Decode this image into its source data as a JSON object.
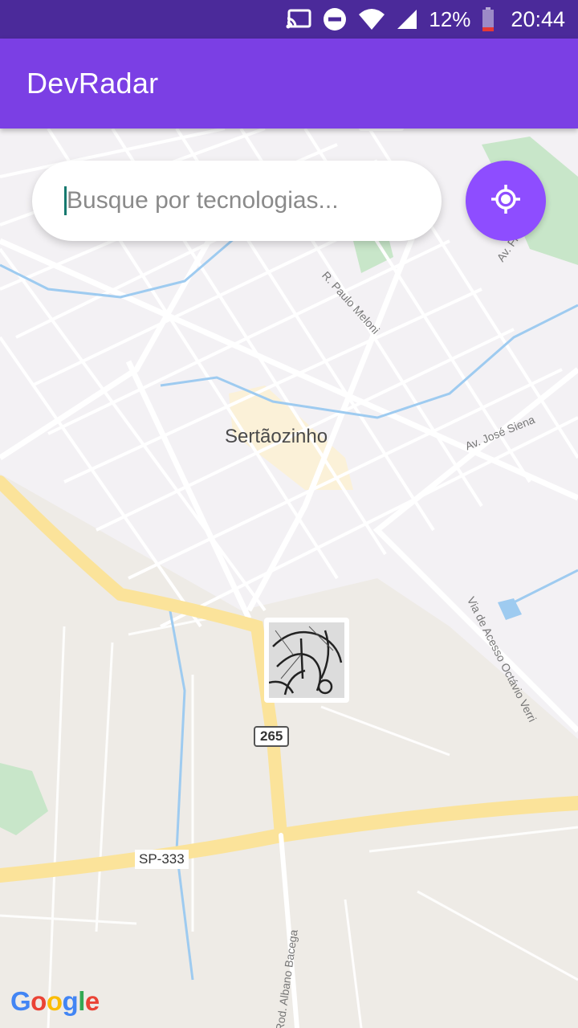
{
  "status_bar": {
    "battery_percent": "12%",
    "time": "20:44"
  },
  "app": {
    "title": "DevRadar"
  },
  "search": {
    "placeholder": "Busque por tecnologias...",
    "value": ""
  },
  "map": {
    "city_label": "Sertãozinho",
    "street_labels": {
      "paulo_meloni": "R. Paulo Meloni",
      "av_jose_siena": "Av. José Siena",
      "av_frascico": "Av. Frascico",
      "via_acesso": "Via de Acesso Octávio Verri",
      "rod_albano": "Rod. Albano Bacega"
    },
    "shield_265": "265",
    "sp_333": "SP-333",
    "attribution": "Google"
  },
  "icons": {
    "locate": "my-location-icon",
    "cast": "cast-icon",
    "dnd": "do-not-disturb-icon",
    "wifi": "wifi-icon",
    "signal": "signal-icon",
    "battery": "battery-icon"
  },
  "colors": {
    "status_bar": "#4b2a9a",
    "app_bar": "#7b3fe4",
    "locate_button": "#8e4dff"
  }
}
